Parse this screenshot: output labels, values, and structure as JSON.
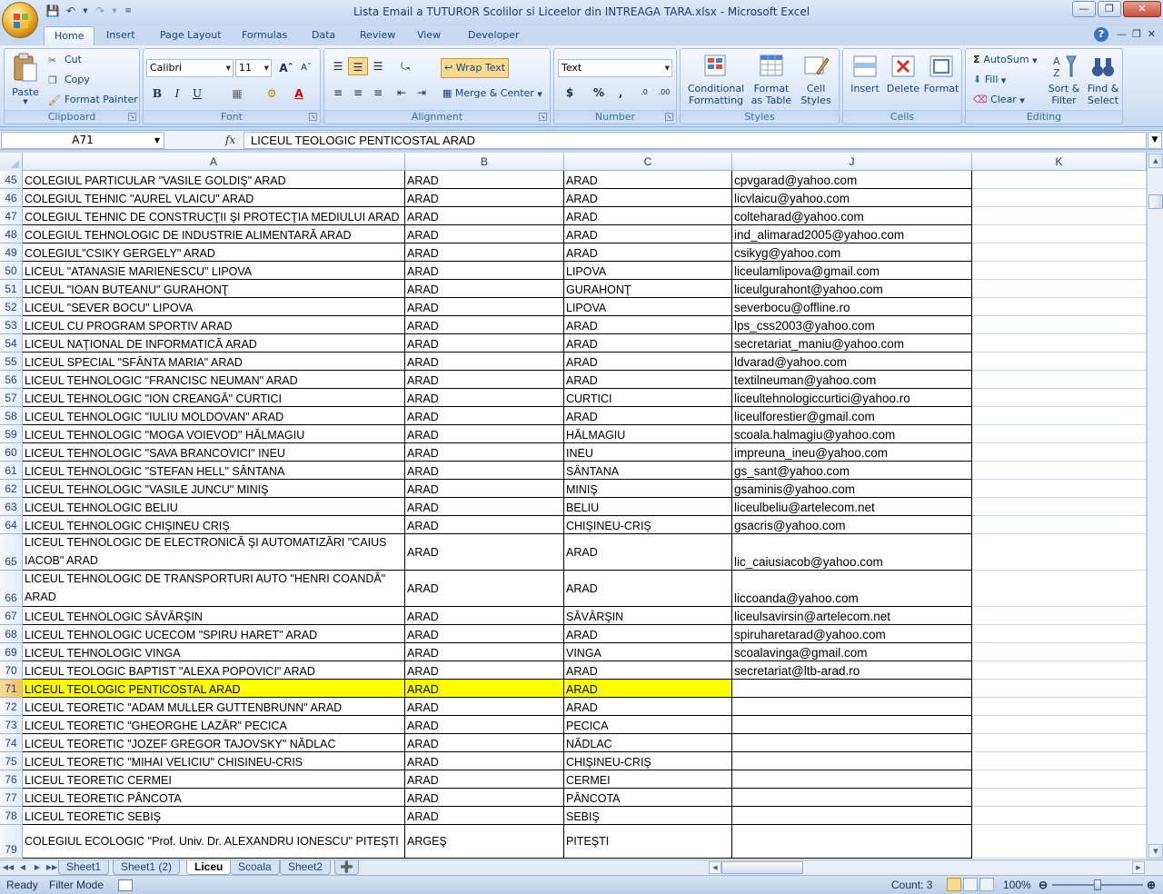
{
  "window": {
    "title": "Lista Email a TUTUROR Scolilor si Liceelor din INTREAGA TARA.xlsx - Microsoft Excel"
  },
  "ribbon_tabs": [
    "Home",
    "Insert",
    "Page Layout",
    "Formulas",
    "Data",
    "Review",
    "View",
    "Developer"
  ],
  "active_tab": "Home",
  "clipboard": {
    "paste": "Paste",
    "cut": "Cut",
    "copy": "Copy",
    "format_painter": "Format Painter",
    "label": "Clipboard"
  },
  "font": {
    "name": "Calibri",
    "size": "11",
    "label": "Font",
    "bold": "B",
    "italic": "I",
    "underline": "U"
  },
  "alignment": {
    "wrap_text": "Wrap Text",
    "merge_center": "Merge & Center",
    "label": "Alignment"
  },
  "number": {
    "format": "Text",
    "currency": "$",
    "percent": "%",
    "comma": ",",
    "label": "Number",
    "inc_decimal": ".0→.00",
    "dec_decimal": ".00→.0"
  },
  "styles": {
    "conditional": "Conditional",
    "conditional2": "Formatting",
    "format_table": "Format",
    "format_table2": "as Table",
    "cell_styles": "Cell",
    "cell_styles2": "Styles",
    "label": "Styles"
  },
  "cells": {
    "insert": "Insert",
    "delete": "Delete",
    "format": "Format",
    "label": "Cells"
  },
  "editing": {
    "autosum": "AutoSum",
    "fill": "Fill",
    "clear": "Clear",
    "sort": "Sort &",
    "sort2": "Filter",
    "find": "Find &",
    "find2": "Select",
    "label": "Editing"
  },
  "formula_bar": {
    "name_box": "A71",
    "fx": "fx",
    "content": "LICEUL TEOLOGIC PENTICOSTAL ARAD"
  },
  "columns": [
    "A",
    "B",
    "C",
    "J",
    "K"
  ],
  "rows": [
    {
      "n": "45",
      "a": "COLEGIUL PARTICULAR \"VASILE GOLDIŞ\" ARAD",
      "b": "ARAD",
      "c": "ARAD",
      "j": "cpvgarad@yahoo.com"
    },
    {
      "n": "46",
      "a": "COLEGIUL TEHNIC \"AUREL VLAICU\" ARAD",
      "b": "ARAD",
      "c": "ARAD",
      "j": "licvlaicu@yahoo.com"
    },
    {
      "n": "47",
      "a": "COLEGIUL TEHNIC DE CONSTRUCŢII ŞI PROTECŢIA MEDIULUI ARAD",
      "b": "ARAD",
      "c": "ARAD",
      "j": "colteharad@yahoo.com"
    },
    {
      "n": "48",
      "a": "COLEGIUL TEHNOLOGIC DE INDUSTRIE ALIMENTARĂ ARAD",
      "b": "ARAD",
      "c": "ARAD",
      "j": "ind_alimarad2005@yahoo.com"
    },
    {
      "n": "49",
      "a": "COLEGIUL\"CSIKY GERGELY\" ARAD",
      "b": "ARAD",
      "c": "ARAD",
      "j": "csikyg@yahoo.com"
    },
    {
      "n": "50",
      "a": "LICEUL \"ATANASIE MARIENESCU\" LIPOVA",
      "b": "ARAD",
      "c": "LIPOVA",
      "j": "liceulamlipova@gmail.com"
    },
    {
      "n": "51",
      "a": "LICEUL \"IOAN BUTEANU\" GURAHONŢ",
      "b": "ARAD",
      "c": "GURAHONŢ",
      "j": "liceulgurahont@yahoo.com"
    },
    {
      "n": "52",
      "a": "LICEUL \"SEVER BOCU\" LIPOVA",
      "b": "ARAD",
      "c": "LIPOVA",
      "j": "severbocu@offline.ro"
    },
    {
      "n": "53",
      "a": "LICEUL CU PROGRAM SPORTIV ARAD",
      "b": "ARAD",
      "c": "ARAD",
      "j": "lps_css2003@yahoo.com"
    },
    {
      "n": "54",
      "a": "LICEUL NAŢIONAL DE INFORMATICĂ ARAD",
      "b": "ARAD",
      "c": "ARAD",
      "j": "secretariat_maniu@yahoo.com"
    },
    {
      "n": "55",
      "a": "LICEUL SPECIAL \"SFÂNTA MARIA\" ARAD",
      "b": "ARAD",
      "c": "ARAD",
      "j": "ldvarad@yahoo.com"
    },
    {
      "n": "56",
      "a": "LICEUL TEHNOLOGIC \"FRANCISC NEUMAN\" ARAD",
      "b": "ARAD",
      "c": "ARAD",
      "j": "textilneuman@yahoo.com"
    },
    {
      "n": "57",
      "a": "LICEUL TEHNOLOGIC \"ION CREANGĂ\" CURTICI",
      "b": "ARAD",
      "c": "CURTICI",
      "j": "liceultehnologiccurtici@yahoo.ro"
    },
    {
      "n": "58",
      "a": "LICEUL TEHNOLOGIC \"IULIU MOLDOVAN\" ARAD",
      "b": "ARAD",
      "c": "ARAD",
      "j": "liceulforestier@gmail.com"
    },
    {
      "n": "59",
      "a": "LICEUL TEHNOLOGIC \"MOGA VOIEVOD\" HĂLMAGIU",
      "b": "ARAD",
      "c": "HĂLMAGIU",
      "j": "scoala.halmagiu@yahoo.com"
    },
    {
      "n": "60",
      "a": "LICEUL TEHNOLOGIC \"SAVA BRANCOVICI\" INEU",
      "b": "ARAD",
      "c": "INEU",
      "j": "impreuna_ineu@yahoo.com"
    },
    {
      "n": "61",
      "a": "LICEUL TEHNOLOGIC \"STEFAN HELL\" SÂNTANA",
      "b": "ARAD",
      "c": "SÂNTANA",
      "j": "gs_sant@yahoo.com"
    },
    {
      "n": "62",
      "a": "LICEUL TEHNOLOGIC \"VASILE JUNCU\" MINIŞ",
      "b": "ARAD",
      "c": "MINIŞ",
      "j": "gsaminis@yahoo.com"
    },
    {
      "n": "63",
      "a": "LICEUL TEHNOLOGIC BELIU",
      "b": "ARAD",
      "c": "BELIU",
      "j": "liceulbeliu@artelecom.net"
    },
    {
      "n": "64",
      "a": "LICEUL TEHNOLOGIC CHIŞINEU CRIŞ",
      "b": "ARAD",
      "c": "CHIŞINEU-CRIŞ",
      "j": "gsacris@yahoo.com"
    },
    {
      "n": "65",
      "a": "LICEUL TEHNOLOGIC DE ELECTRONICĂ ŞI AUTOMATIZĂRI \"CAIUS IACOB\" ARAD",
      "b": "ARAD",
      "c": "ARAD",
      "j": "lic_caiusiacob@yahoo.com",
      "tall": true
    },
    {
      "n": "66",
      "a": "LICEUL TEHNOLOGIC DE TRANSPORTURI AUTO \"HENRI COANDĂ\" ARAD",
      "b": "ARAD",
      "c": "ARAD",
      "j": "liccoanda@yahoo.com",
      "tall": true
    },
    {
      "n": "67",
      "a": "LICEUL TEHNOLOGIC SĂVÂRŞIN",
      "b": "ARAD",
      "c": "SĂVÂRŞIN",
      "j": "liceulsavirsin@artelecom.net"
    },
    {
      "n": "68",
      "a": "LICEUL TEHNOLOGIC UCECOM \"SPIRU HARET\" ARAD",
      "b": "ARAD",
      "c": "ARAD",
      "j": "spiruharetarad@yahoo.com"
    },
    {
      "n": "69",
      "a": "LICEUL TEHNOLOGIC VINGA",
      "b": "ARAD",
      "c": "VINGA",
      "j": "scoalavinga@gmail.com"
    },
    {
      "n": "70",
      "a": "LICEUL TEOLOGIC BAPTIST \"ALEXA POPOVICI\" ARAD",
      "b": "ARAD",
      "c": "ARAD",
      "j": "secretariat@ltb-arad.ro"
    },
    {
      "n": "71",
      "a": "LICEUL TEOLOGIC PENTICOSTAL ARAD",
      "b": "ARAD",
      "c": "ARAD",
      "j": "",
      "highlight": true
    },
    {
      "n": "72",
      "a": "LICEUL TEORETIC \"ADAM MULLER GUTTENBRUNN\" ARAD",
      "b": "ARAD",
      "c": "ARAD",
      "j": ""
    },
    {
      "n": "73",
      "a": "LICEUL TEORETIC \"GHEORGHE LAZĂR\" PECICA",
      "b": "ARAD",
      "c": "PECICA",
      "j": ""
    },
    {
      "n": "74",
      "a": "LICEUL TEORETIC \"JOZEF GREGOR TAJOVSKY\" NĂDLAC",
      "b": "ARAD",
      "c": "NĂDLAC",
      "j": ""
    },
    {
      "n": "75",
      "a": "LICEUL TEORETIC \"MIHAI VELICIU\" CHISINEU-CRIS",
      "b": "ARAD",
      "c": "CHIŞINEU-CRIŞ",
      "j": ""
    },
    {
      "n": "76",
      "a": "LICEUL TEORETIC CERMEI",
      "b": "ARAD",
      "c": "CERMEI",
      "j": ""
    },
    {
      "n": "77",
      "a": "LICEUL TEORETIC PÂNCOTA",
      "b": "ARAD",
      "c": "PÂNCOTA",
      "j": ""
    },
    {
      "n": "78",
      "a": "LICEUL TEORETIC SEBIŞ",
      "b": "ARAD",
      "c": "SEBIŞ",
      "j": ""
    },
    {
      "n": "79",
      "a": "COLEGIUL ECOLOGIC \"Prof. Univ. Dr. ALEXANDRU IONESCU\" PITEŞTI",
      "b": "ARGEŞ",
      "c": "PITEŞTI",
      "j": "",
      "tall": true,
      "last": true
    }
  ],
  "sheets": [
    "Sheet1",
    "Sheet1 (2)",
    "Liceu",
    "Scoala",
    "Sheet2"
  ],
  "active_sheet": "Liceu",
  "status": {
    "ready": "Ready",
    "filter_mode": "Filter Mode",
    "count": "Count: 3",
    "zoom": "100%"
  },
  "colors": {
    "highlight": "#ffff00",
    "ribbon": "#d6e4f6",
    "accent": "#15428b"
  }
}
